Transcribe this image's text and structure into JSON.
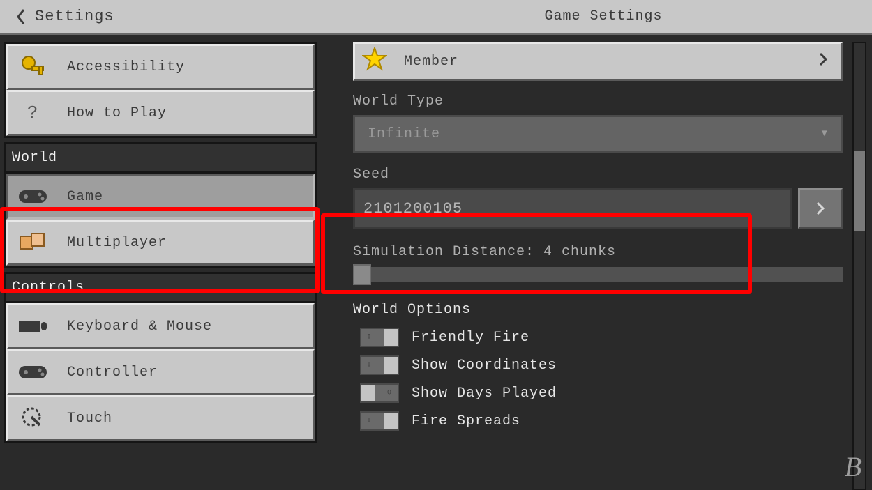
{
  "header": {
    "back_label": "Settings",
    "page_title": "Game Settings"
  },
  "sidebar": {
    "top": [
      {
        "label": "Accessibility",
        "icon": "key"
      },
      {
        "label": "How to Play",
        "icon": "question"
      }
    ],
    "world_heading": "World",
    "world": [
      {
        "label": "Game",
        "icon": "gamepad",
        "selected": true
      },
      {
        "label": "Multiplayer",
        "icon": "friends"
      }
    ],
    "controls_heading": "Controls",
    "controls": [
      {
        "label": "Keyboard & Mouse",
        "icon": "keyboard"
      },
      {
        "label": "Controller",
        "icon": "gamepad"
      },
      {
        "label": "Touch",
        "icon": "touch"
      }
    ]
  },
  "main": {
    "member_label": "Member",
    "world_type_label": "World Type",
    "world_type_value": "Infinite",
    "seed_label": "Seed",
    "seed_value": "2101200105",
    "sim_distance_label": "Simulation Distance: 4 chunks",
    "world_options_label": "World Options",
    "toggles": [
      {
        "label": "Friendly Fire",
        "on": true
      },
      {
        "label": "Show Coordinates",
        "on": true
      },
      {
        "label": "Show Days Played",
        "on": false
      },
      {
        "label": "Fire Spreads",
        "on": true
      }
    ]
  }
}
